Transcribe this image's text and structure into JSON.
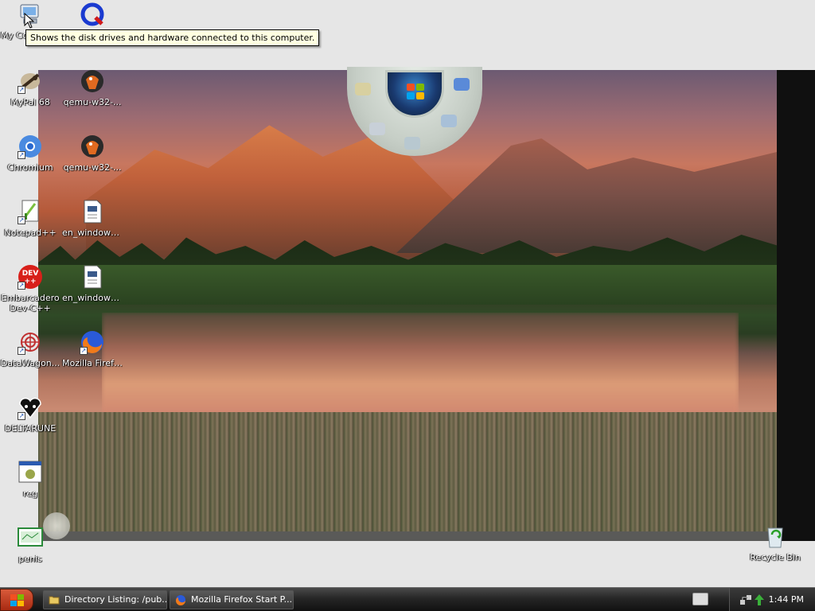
{
  "tooltip": "Shows the disk drives and hardware connected to this computer.",
  "icons": {
    "my_computer": "My Computer",
    "qemu_top": "",
    "mypal": "MyPal 68",
    "qemu1": "qemu-w32-...",
    "chromium": "Chromium",
    "qemu2": "qemu-w32-...",
    "notepadpp": "Notepad++",
    "enwin1": "en_windows...",
    "devcpp": "Embarcadero Dev-C++",
    "enwin2": "en_windows...",
    "datawagon": "DataWagon...",
    "firefox": "Mozilla Firefox",
    "deltarune": "DELTARUNE",
    "reg": "reg",
    "penis": "penis",
    "recycle_bin": "Recycle Bin"
  },
  "taskbar": {
    "tasks": [
      {
        "label": "Directory Listing: /pub...",
        "icon": "folder-icon"
      },
      {
        "label": "Mozilla Firefox Start P...",
        "icon": "firefox-icon"
      }
    ],
    "clock": "1:44 PM"
  },
  "colors": {
    "tooltip_bg": "#ffffe1",
    "taskbar_bg": "#262626",
    "start_button": "#c0401e"
  }
}
